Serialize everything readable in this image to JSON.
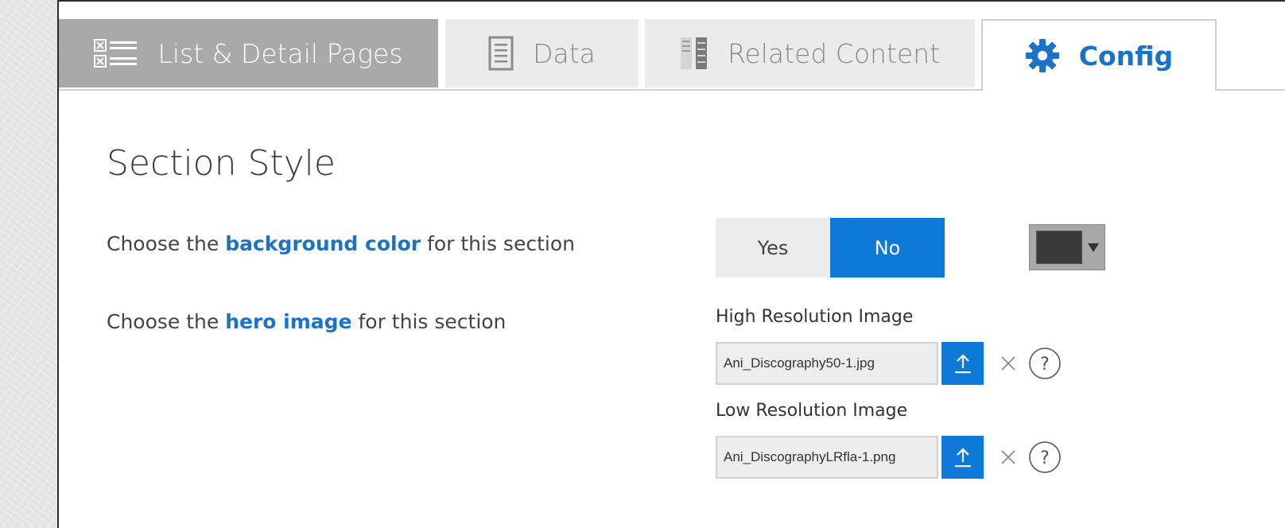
{
  "tabs": {
    "list": "List & Detail Pages",
    "data": "Data",
    "related": "Related Content",
    "config": "Config"
  },
  "section": {
    "title": "Section Style",
    "background_row": {
      "prefix": "Choose the ",
      "highlight": "background color",
      "suffix": " for this section"
    },
    "hero_row": {
      "prefix": "Choose the ",
      "highlight": "hero image",
      "suffix": " for this section"
    },
    "toggle": {
      "yes": "Yes",
      "no": "No",
      "selected": "No"
    },
    "color_value": "#3a3a3a",
    "high_res": {
      "label": "High Resolution Image",
      "filename": "Ani_Discography50-1.jpg"
    },
    "low_res": {
      "label": "Low Resolution Image",
      "filename": "Ani_DiscographyLRfla-1.png"
    }
  },
  "colors": {
    "accent": "#0f79d8",
    "active_tab_bg": "#a9a9a9",
    "link": "#1a73c9"
  }
}
